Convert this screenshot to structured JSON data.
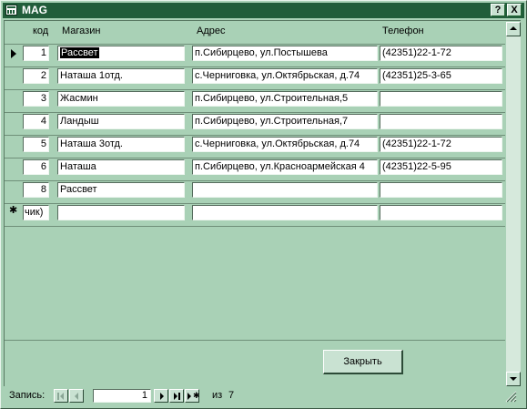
{
  "window": {
    "title": "MAG",
    "help_label": "?",
    "close_label": "X"
  },
  "headers": {
    "code": "код",
    "shop": "Магазин",
    "address": "Адрес",
    "phone": "Телефон"
  },
  "rows": [
    {
      "code": "1",
      "shop": "Рассвет",
      "address": "п.Сибирцево, ул.Постышева",
      "phone": "(42351)22-1-72"
    },
    {
      "code": "2",
      "shop": "Наташа 1отд.",
      "address": "с.Черниговка, ул.Октябрьская, д.74",
      "phone": "(42351)25-3-65"
    },
    {
      "code": "3",
      "shop": "Жасмин",
      "address": "п.Сибирцево, ул.Строительная,5",
      "phone": ""
    },
    {
      "code": "4",
      "shop": "Ландыш",
      "address": "п.Сибирцево, ул.Строительная,7",
      "phone": ""
    },
    {
      "code": "5",
      "shop": "Наташа 3отд.",
      "address": "с.Черниговка, ул.Октябрьская, д.74",
      "phone": "(42351)22-1-72"
    },
    {
      "code": "6",
      "shop": "Наташа",
      "address": "п.Сибирцево, ул.Красноармейская 4",
      "phone": "(42351)22-5-95"
    },
    {
      "code": "8",
      "shop": "Рассвет",
      "address": "",
      "phone": ""
    }
  ],
  "new_row": {
    "code": "чик)",
    "shop": "",
    "address": "",
    "phone": ""
  },
  "close_button": "Закрыть",
  "nav": {
    "label": "Запись:",
    "current": "1",
    "of_label": "из",
    "total": "7"
  }
}
